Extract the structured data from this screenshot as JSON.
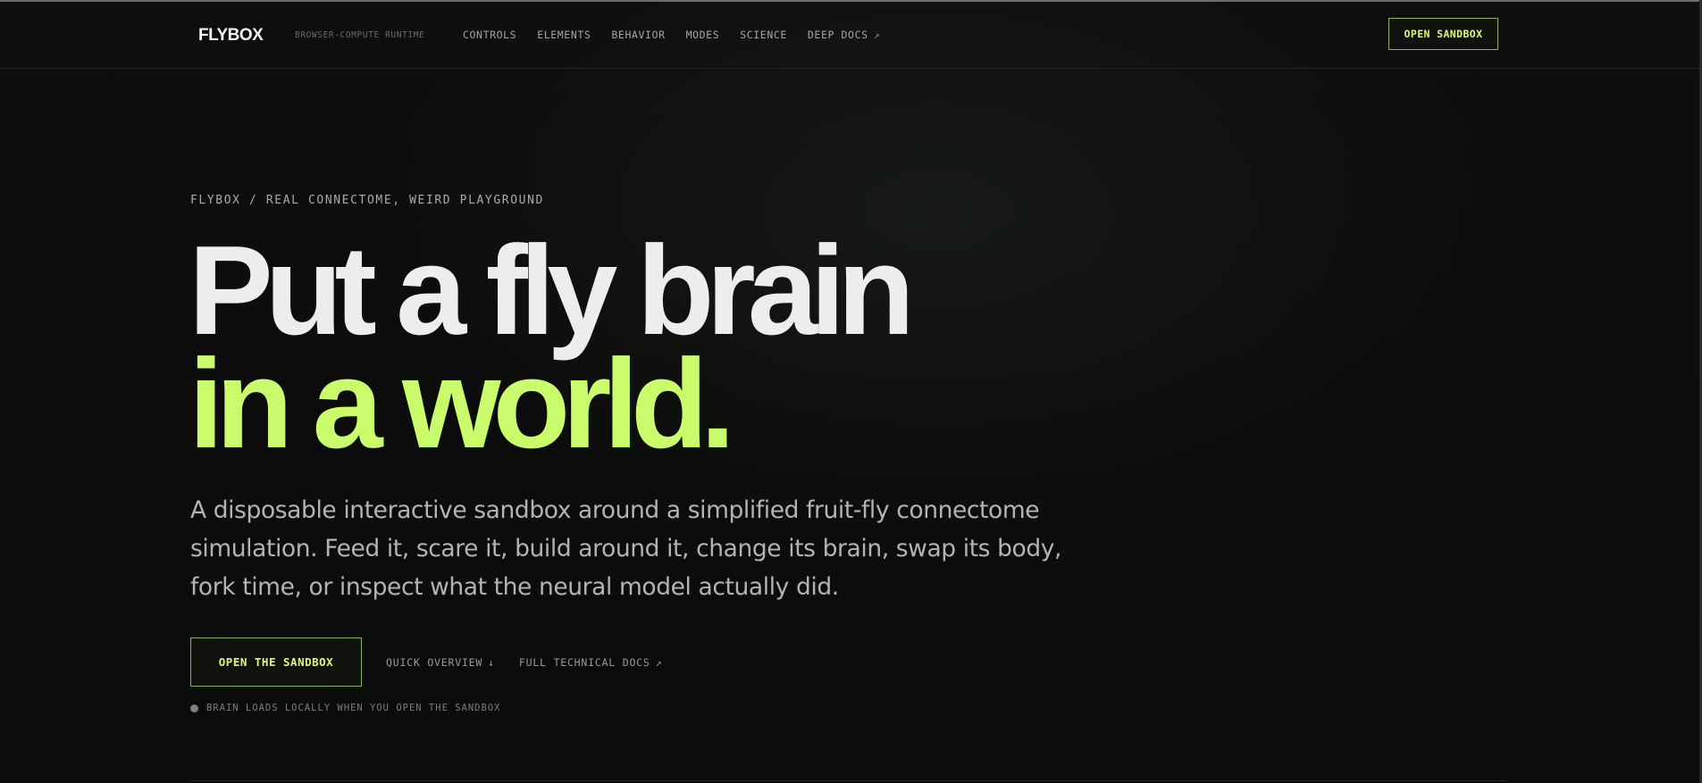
{
  "nav": {
    "logo": "FLYBOX",
    "tagline": "BROWSER-COMPUTE RUNTIME",
    "links": [
      {
        "label": "CONTROLS"
      },
      {
        "label": "ELEMENTS"
      },
      {
        "label": "BEHAVIOR"
      },
      {
        "label": "MODES"
      },
      {
        "label": "SCIENCE"
      },
      {
        "label": "DEEP DOCS",
        "icon": "external-link-icon",
        "glyph": "↗"
      }
    ],
    "cta_label": "OPEN SANDBOX"
  },
  "hero": {
    "eyebrow": "FLYBOX / REAL CONNECTOME, WEIRD PLAYGROUND",
    "headline_line1": "Put a fly brain",
    "headline_line2": "in a world.",
    "lede": "A disposable interactive sandbox around a simplified fruit-fly connectome simulation. Feed it, scare it, build around it, change its brain, swap its body, fork time, or inspect what the neural model actually did.",
    "primary_cta": "OPEN THE SANDBOX",
    "overview_link": "QUICK OVERVIEW",
    "overview_icon": "arrow-down-icon",
    "overview_glyph": "↓",
    "docs_link": "FULL TECHNICAL DOCS",
    "docs_icon": "external-link-icon",
    "docs_glyph": "↗",
    "status_text": "BRAIN LOADS LOCALLY WHEN YOU OPEN THE SANDBOX"
  },
  "colors": {
    "background": "#0b0c0b",
    "accent": "#c9fb6a",
    "headline": "#eceeec",
    "muted": "#b1b5b1"
  }
}
